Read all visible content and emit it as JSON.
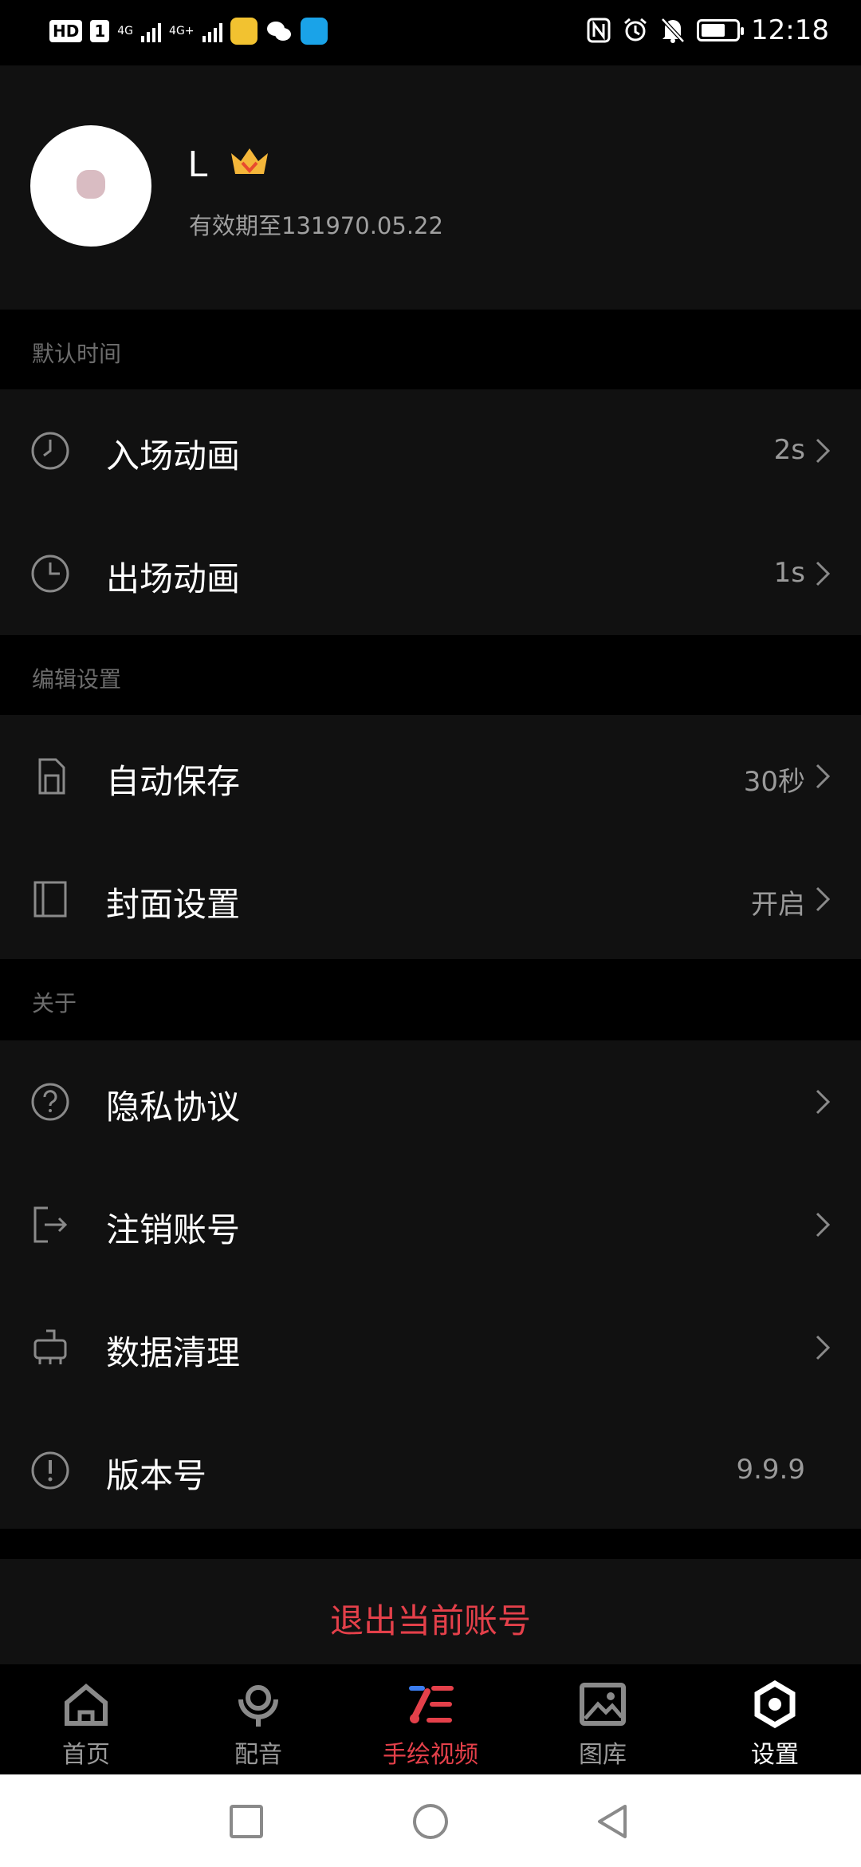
{
  "status_bar": {
    "hd": "HD",
    "sim1": "1",
    "net1": "4G",
    "net2": "4G+",
    "time": "12:18"
  },
  "profile": {
    "username": "L",
    "expiry": "有效期至131970.05.22"
  },
  "sections": [
    {
      "title": "默认时间",
      "items": [
        {
          "label": "入场动画",
          "value": "2s",
          "icon": "clock-icon"
        },
        {
          "label": "出场动画",
          "value": "1s",
          "icon": "clock-icon"
        }
      ]
    },
    {
      "title": "编辑设置",
      "items": [
        {
          "label": "自动保存",
          "value": "30秒",
          "icon": "sd-card-icon"
        },
        {
          "label": "封面设置",
          "value": "开启",
          "icon": "cover-icon"
        }
      ]
    },
    {
      "title": "关于",
      "items": [
        {
          "label": "隐私协议",
          "value": "",
          "icon": "question-icon"
        },
        {
          "label": "注销账号",
          "value": "",
          "icon": "logout-icon"
        },
        {
          "label": "数据清理",
          "value": "",
          "icon": "broom-icon"
        },
        {
          "label": "版本号",
          "value": "9.9.9",
          "icon": "info-icon"
        }
      ]
    }
  ],
  "logout_label": "退出当前账号",
  "bottom_nav": [
    {
      "label": "首页",
      "icon": "home-icon"
    },
    {
      "label": "配音",
      "icon": "dubbing-icon"
    },
    {
      "label": "手绘视频",
      "icon": "hand-draw-icon"
    },
    {
      "label": "图库",
      "icon": "gallery-icon"
    },
    {
      "label": "设置",
      "icon": "settings-icon"
    }
  ],
  "colors": {
    "accent": "#e4404a",
    "background": "#000000",
    "surface": "#111111",
    "muted": "#9a9a9a"
  }
}
